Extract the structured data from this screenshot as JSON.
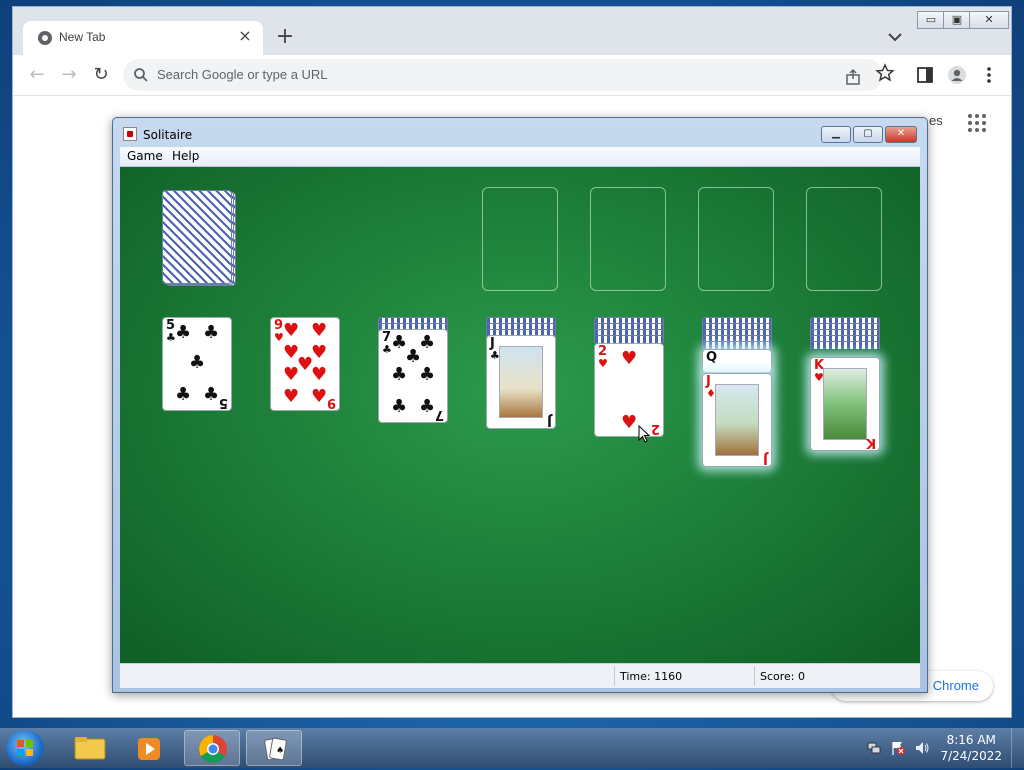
{
  "chrome": {
    "tab_title": "New Tab",
    "tab_close": "×",
    "new_tab": "+",
    "omnibox_placeholder": "Search Google or type a URL",
    "ntp_partial_text": "es",
    "customize_label": "Chrome"
  },
  "solitaire": {
    "title": "Solitaire",
    "menu": [
      "Game",
      "Help"
    ],
    "status": {
      "time": "Time: 1160",
      "score": "Score: 0"
    },
    "tableau": [
      {
        "rank": "5",
        "suit": "♣",
        "color": "black"
      },
      {
        "rank": "9",
        "suit": "♥",
        "color": "red"
      },
      {
        "rank": "7",
        "suit": "♣",
        "color": "black"
      },
      {
        "rank": "J",
        "suit": "♣",
        "color": "black"
      },
      {
        "rank": "2",
        "suit": "♥",
        "color": "red"
      },
      {
        "rank": "Q",
        "suit": "",
        "color": "black"
      },
      {
        "rank": "J",
        "suit": "♦",
        "color": "red"
      },
      {
        "rank": "K",
        "suit": "♥",
        "color": "red"
      }
    ]
  },
  "taskbar": {
    "time": "8:16 AM",
    "date": "7/24/2022"
  },
  "colors": {
    "felt": "#1c7d38",
    "desktop": "#1a5fa3",
    "chrome_tabstrip": "#dfe3ea"
  }
}
